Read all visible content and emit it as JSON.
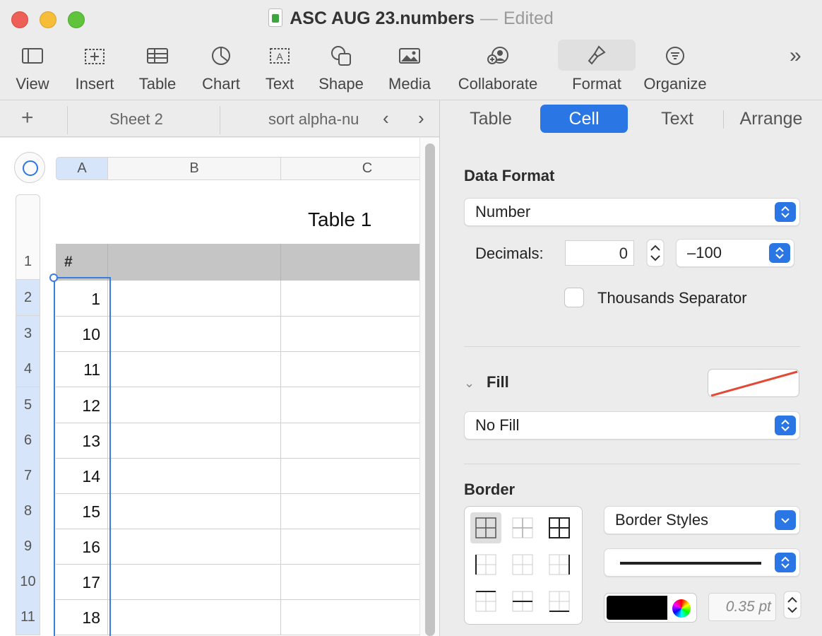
{
  "window": {
    "filename": "ASC AUG 23.numbers",
    "dash": "—",
    "status": "Edited"
  },
  "toolbar": {
    "items": [
      {
        "label": "View",
        "icon": "sidebar-view-icon"
      },
      {
        "label": "Insert",
        "icon": "insert-icon"
      },
      {
        "label": "Table",
        "icon": "table-icon"
      },
      {
        "label": "Chart",
        "icon": "chart-icon"
      },
      {
        "label": "Text",
        "icon": "text-box-icon"
      },
      {
        "label": "Shape",
        "icon": "shape-icon"
      },
      {
        "label": "Media",
        "icon": "media-icon"
      },
      {
        "label": "Collaborate",
        "icon": "collaborate-icon"
      },
      {
        "label": "Format",
        "icon": "format-brush-icon",
        "active": true
      },
      {
        "label": "Organize",
        "icon": "organize-icon"
      }
    ],
    "overflow": "»"
  },
  "sheets": {
    "add": "+",
    "tabs": [
      "Sheet 2",
      "sort alpha-nu"
    ],
    "prev": "‹",
    "next": "›"
  },
  "table": {
    "title": "Table 1",
    "columns": [
      "A",
      "B",
      "C"
    ],
    "header": [
      "#",
      "",
      ""
    ],
    "row_numbers": [
      "1",
      "2",
      "3",
      "4",
      "5",
      "6",
      "7",
      "8",
      "9",
      "10",
      "11"
    ],
    "values": [
      "1",
      "10",
      "11",
      "12",
      "13",
      "14",
      "15",
      "16",
      "17",
      "18"
    ]
  },
  "inspector": {
    "tabs": [
      "Table",
      "Cell",
      "Text",
      "Arrange"
    ],
    "active_tab": "Cell",
    "data_format": {
      "title": "Data Format",
      "format": "Number",
      "decimals_label": "Decimals:",
      "decimals": "0",
      "negative_style": "–100",
      "thousands_label": "Thousands Separator",
      "thousands": false
    },
    "fill": {
      "title": "Fill",
      "value": "No Fill"
    },
    "border": {
      "title": "Border",
      "style": "Border Styles",
      "color": "#000000",
      "width": "0.35 pt"
    },
    "accent_color": "#2b76e5"
  }
}
